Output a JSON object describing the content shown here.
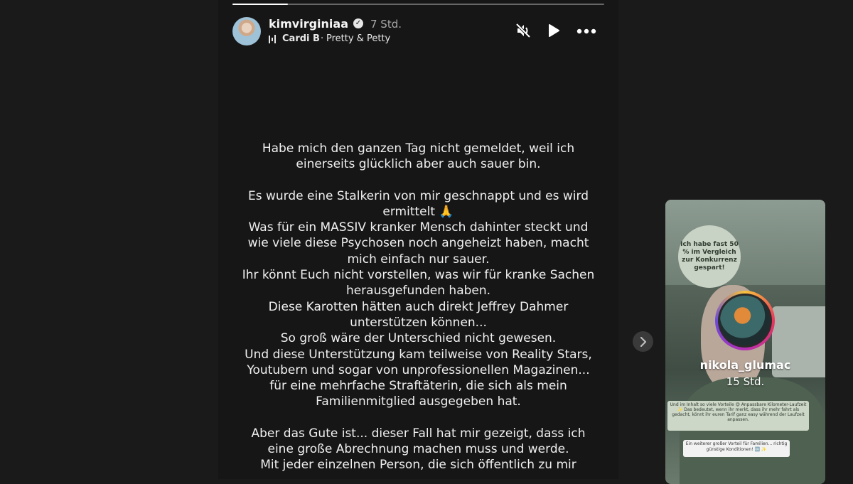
{
  "story": {
    "progress": 0.15,
    "username": "kimvirginiaa",
    "verified_glyph": "✓",
    "time": "7 Std.",
    "music": {
      "artist": "Cardi B",
      "separator": "·",
      "song": "Pretty & Petty"
    },
    "controls": {
      "mute_icon": "speaker-muted-icon",
      "play_icon": "play-icon",
      "more_icon": "more-icon"
    },
    "caption": {
      "p1": [
        "Habe mich den ganzen Tag nicht gemeldet, weil ich",
        "einerseits glücklich aber auch sauer bin."
      ],
      "p2": [
        "Es wurde eine Stalkerin von mir geschnappt und es wird",
        "ermittelt 🙏",
        "Was für ein MASSIV kranker Mensch dahinter steckt und",
        "wie viele diese Psychosen noch angeheizt haben, macht",
        "mich einfach nur sauer.",
        "Ihr könnt Euch nicht vorstellen, was wir für kranke Sachen",
        "herausgefunden haben.",
        "Diese Karotten hätten auch direkt Jeffrey Dahmer",
        "unterstützen können...",
        "So groß wäre der Unterschied nicht gewesen.",
        "Und diese Unterstützung kam teilweise von Reality Stars,",
        "Youtubern und sogar von unprofessionellen Magazinen...",
        "für eine mehrfache Straftäterin, die sich als mein",
        "Familienmitglied ausgegeben hat."
      ],
      "p3": [
        "Aber das Gute ist... dieser Fall hat mir gezeigt, dass ich",
        "eine große Abrechnung machen muss und werde.",
        "Mit jeder einzelnen Person, die sich öffentlich zu mir"
      ]
    }
  },
  "next_story": {
    "username": "nikola_glumac",
    "time": "15 Std.",
    "sticker_text": "Ich habe fast 50 % im Vergleich zur Konkurrenz gespart!",
    "textbox1": "Und im Inhalt so viele Vorteile 😍 Anpassbare Kilometer-Laufzeit ✨ Das bedeutet, wenn ihr merkt, dass ihr mehr fahrt als gedacht, könnt ihr euren Tarif ganz easy während der Laufzeit anpassen.",
    "textbox2": "Ein weiterer großer Vorteil für Familien... richtig günstige Konditionen! 🆗 ✨",
    "nav_icon": "chevron-right-icon"
  }
}
